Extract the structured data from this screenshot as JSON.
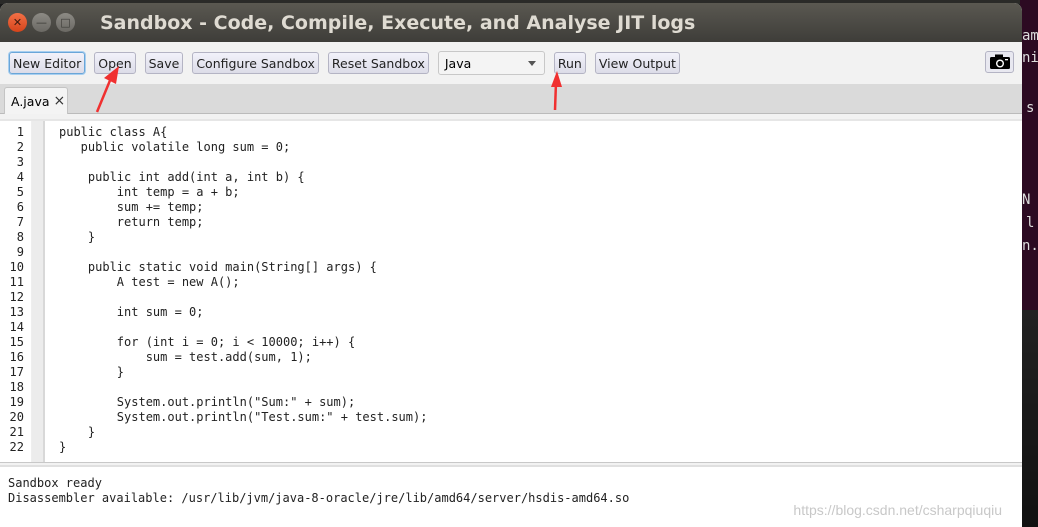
{
  "window": {
    "title": "Sandbox - Code, Compile, Execute, and Analyse JIT logs"
  },
  "toolbar": {
    "new_editor": "New Editor",
    "open": "Open",
    "save": "Save",
    "configure_sandbox": "Configure Sandbox",
    "reset_sandbox": "Reset Sandbox",
    "language_selected": "Java",
    "run": "Run",
    "view_output": "View Output"
  },
  "tabs": [
    {
      "label": "A.java",
      "close": "×"
    }
  ],
  "editor": {
    "lines": [
      "public class A{",
      "   public volatile long sum = 0;",
      "",
      "    public int add(int a, int b) {",
      "        int temp = a + b;",
      "        sum += temp;",
      "        return temp;",
      "    }",
      "",
      "    public static void main(String[] args) {",
      "        A test = new A();",
      "",
      "        int sum = 0;",
      "",
      "        for (int i = 0; i < 10000; i++) {",
      "            sum = test.add(sum, 1);",
      "        }",
      "",
      "        System.out.println(\"Sum:\" + sum);",
      "        System.out.println(\"Test.sum:\" + test.sum);",
      "    }",
      "}"
    ]
  },
  "status": {
    "lines": [
      "Sandbox ready",
      "Disassembler available: /usr/lib/jvm/java-8-oracle/jre/lib/amd64/server/hsdis-amd64.so"
    ]
  },
  "background_terminal": {
    "fragments": [
      "am",
      "ni",
      "s",
      "N",
      "l",
      "n."
    ]
  },
  "watermark": "https://blog.csdn.net/csharpqiuqiu",
  "colors": {
    "annotation_arrow": "#f03030",
    "titlebar": "#3e3d39",
    "close_button": "#e9541f"
  }
}
